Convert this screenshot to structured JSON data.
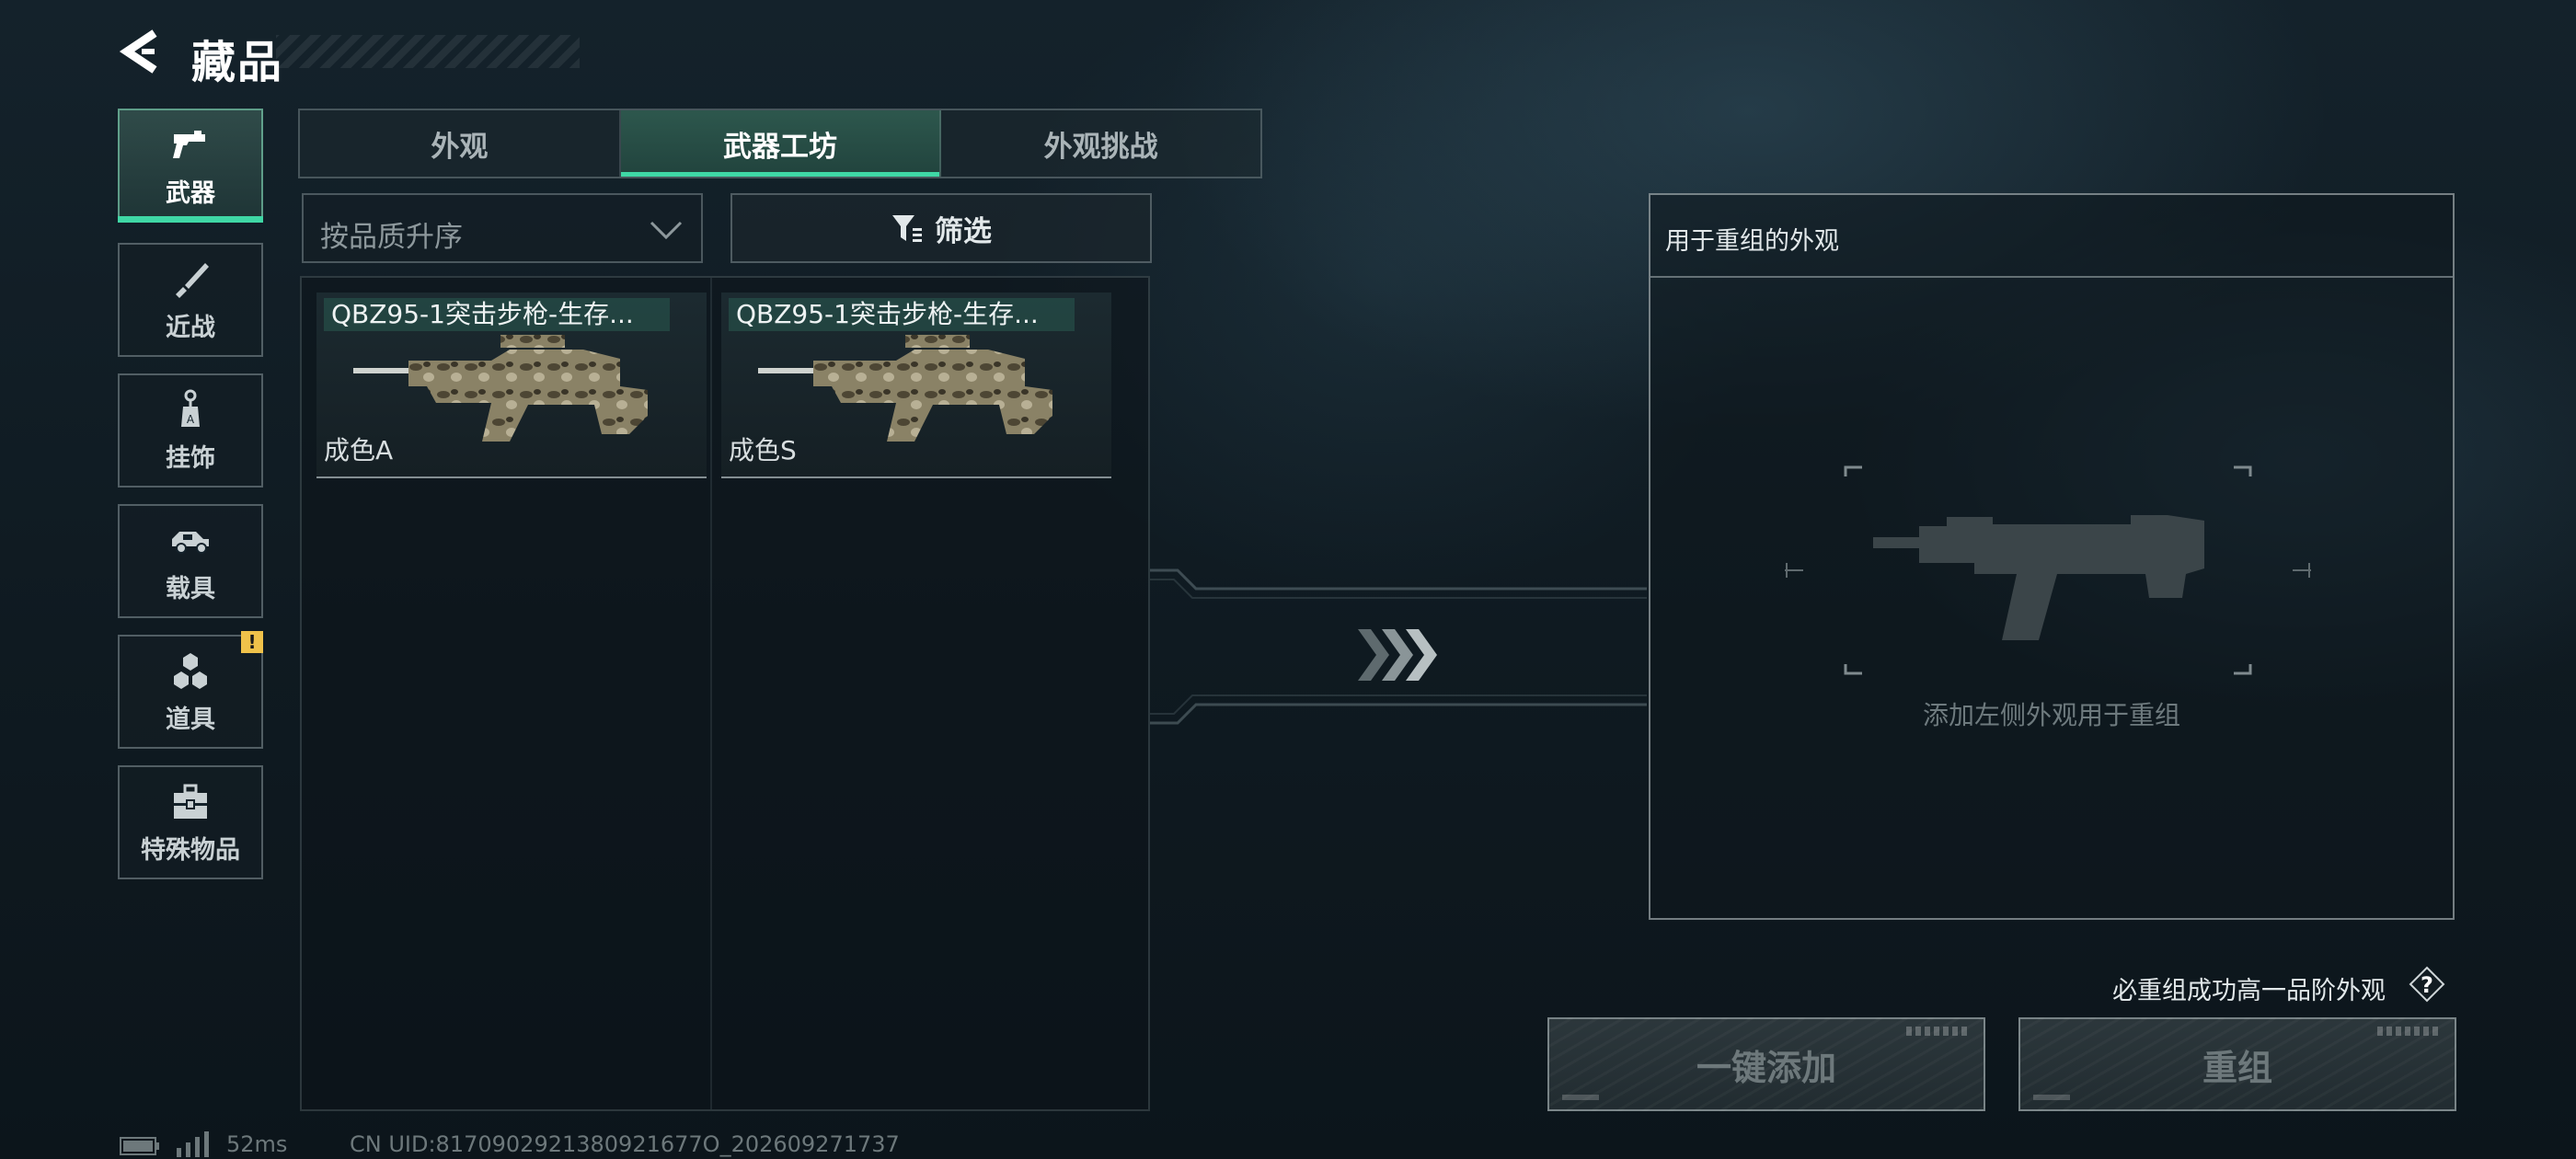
{
  "header": {
    "title": "藏品",
    "back_icon": "back-arrow-icon"
  },
  "sidebar": {
    "items": [
      {
        "label": "武器",
        "icon": "pistol-icon",
        "active": true
      },
      {
        "label": "近战",
        "icon": "knife-icon",
        "active": false
      },
      {
        "label": "挂饰",
        "icon": "charm-icon",
        "active": false
      },
      {
        "label": "载具",
        "icon": "vehicle-icon",
        "active": false
      },
      {
        "label": "道具",
        "icon": "props-icon",
        "active": false,
        "badge": "!"
      },
      {
        "label": "特殊物品",
        "icon": "toolbox-icon",
        "active": false
      }
    ]
  },
  "tabs": [
    {
      "label": "外观",
      "active": false
    },
    {
      "label": "武器工坊",
      "active": true
    },
    {
      "label": "外观挑战",
      "active": false
    }
  ],
  "sort": {
    "value": "按品质升序"
  },
  "filter": {
    "label": "筛选"
  },
  "items": [
    {
      "name": "QBZ95-1突击步枪-生存...",
      "grade": "成色A"
    },
    {
      "name": "QBZ95-1突击步枪-生存...",
      "grade": "成色S"
    }
  ],
  "reorg_panel": {
    "title": "用于重组的外观",
    "hint": "添加左侧外观用于重组"
  },
  "note": {
    "text": "必重组成功高一品阶外观",
    "help": "?"
  },
  "actions": {
    "add_all": "一键添加",
    "reorganize": "重组"
  },
  "status": {
    "latency": "52ms",
    "uid": "CN UID:8170902921380921677O_202609271737"
  },
  "colors": {
    "accent": "#3fd7a5",
    "badge": "#f0c24a"
  }
}
